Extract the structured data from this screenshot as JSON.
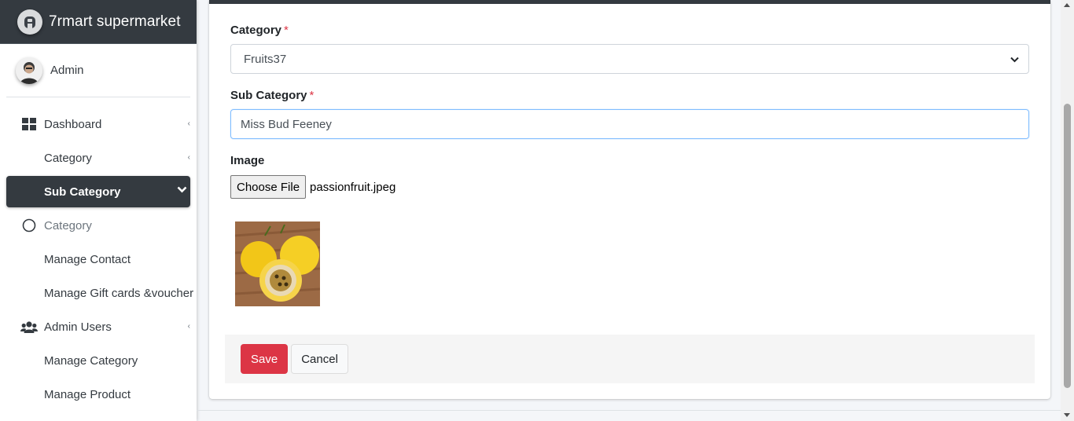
{
  "brand": {
    "name": "7rmart supermarket",
    "logo_icon": "brand-circle-icon"
  },
  "user": {
    "name": "Admin"
  },
  "sidebar": {
    "items": [
      {
        "label": "Dashboard",
        "icon": "dashboard-grid-icon",
        "caret": "‹"
      },
      {
        "label": "Category",
        "caret": "‹"
      },
      {
        "label": "Sub Category",
        "caret": "chevron-down"
      },
      {
        "label": "Category",
        "icon": "circle-outline-icon"
      },
      {
        "label": "Manage Contact"
      },
      {
        "label": "Manage Gift cards &voucher"
      },
      {
        "label": "Admin Users",
        "icon": "users-icon",
        "caret": "‹"
      },
      {
        "label": "Manage Category"
      },
      {
        "label": "Manage Product"
      }
    ]
  },
  "form": {
    "category": {
      "label": "Category",
      "required": "*",
      "value": "Fruits37"
    },
    "sub_category": {
      "label": "Sub Category",
      "required": "*",
      "value": "Miss Bud Feeney"
    },
    "image": {
      "label": "Image",
      "button": "Choose File",
      "file_name": "passionfruit.jpeg"
    }
  },
  "actions": {
    "save": "Save",
    "cancel": "Cancel"
  },
  "colors": {
    "sidebar_dark": "#343a40",
    "danger": "#dc3545",
    "focus_border": "#80bdff"
  }
}
